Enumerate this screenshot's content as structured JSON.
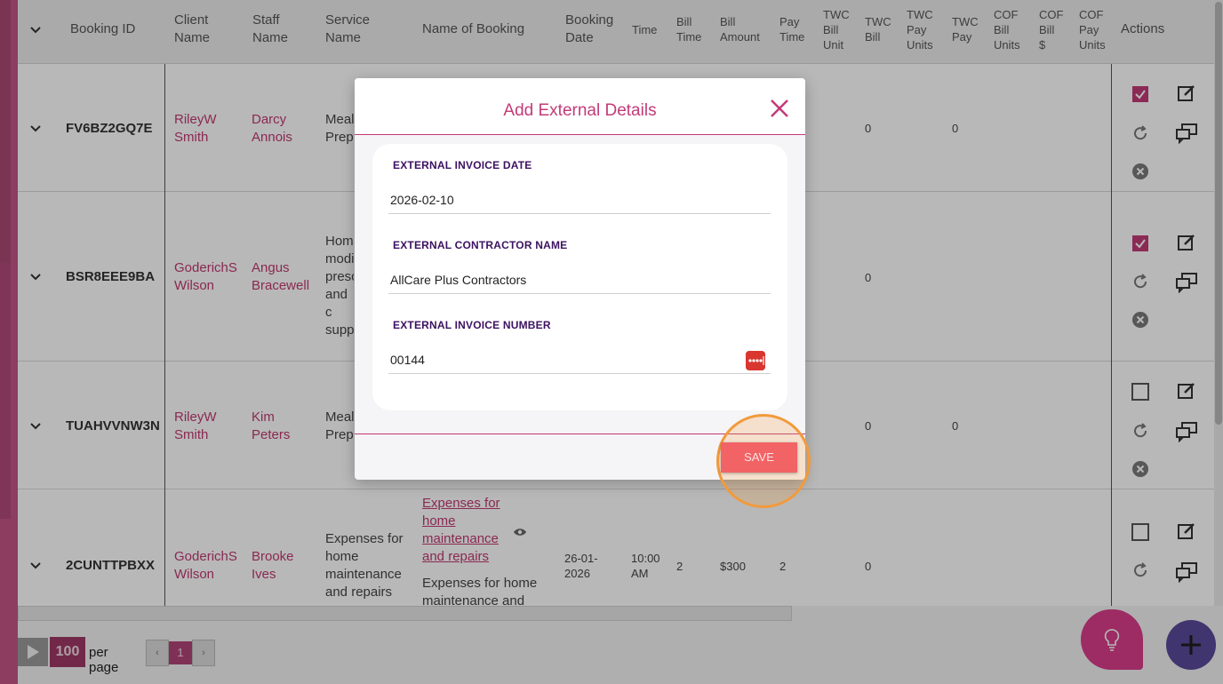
{
  "table": {
    "columns": [
      {
        "label": "Booking ID"
      },
      {
        "label": "Client Name"
      },
      {
        "label": "Staff Name"
      },
      {
        "label": "Service Name"
      },
      {
        "label": "Name of Booking"
      },
      {
        "label": "Booking Date"
      },
      {
        "label": "Time"
      },
      {
        "label": "Bill Time"
      },
      {
        "label": "Bill Amount"
      },
      {
        "label": "Pay Time"
      },
      {
        "label": "TWC Bill Unit"
      },
      {
        "label": "TWC Bill"
      },
      {
        "label": "TWC Pay Units"
      },
      {
        "label": "TWC Pay"
      },
      {
        "label": "COF Bill Units"
      },
      {
        "label": "COF Bill $"
      },
      {
        "label": "COF Pay Units"
      },
      {
        "label": "Actions"
      }
    ],
    "rows": [
      {
        "booking_id": "FV6BZ2GQ7E",
        "client": "RileyW Smith",
        "staff": "Darcy Annois",
        "service": "Meal Prepa",
        "twc_bill": "0",
        "twc_pay": "0",
        "approved": true
      },
      {
        "booking_id": "BSR8EEE9BA",
        "client": "GoderichS Wilson",
        "staff": "Angus Bracewell",
        "service": "Hom modi presc and c supp",
        "twc_bill": "0",
        "twc_pay": "",
        "approved": true
      },
      {
        "booking_id": "TUAHVVNW3N",
        "client": "RileyW Smith",
        "staff": "Kim Peters",
        "service": "Meal Prepa",
        "twc_bill": "0",
        "twc_pay": "0",
        "approved": false
      },
      {
        "booking_id": "2CUNTTPBXX",
        "client": "GoderichS Wilson",
        "staff": "Brooke Ives",
        "service": "Expenses for home maintenance and repairs",
        "booking_name_link": "Expenses for home maintenance and repairs",
        "booking_name_desc": "Expenses for home maintenance and",
        "date": "26-01-2026",
        "time": "10:00 AM",
        "bill_time": "2",
        "bill_amount": "$300",
        "pay_time": "2",
        "twc_bill": "0",
        "twc_pay": "",
        "approved": false
      }
    ]
  },
  "pagination": {
    "page_size": "100",
    "per_page_label": "per page",
    "prev": "‹",
    "next": "›",
    "current_page": "1"
  },
  "modal": {
    "title": "Add External Details",
    "fields": {
      "invoice_date": {
        "label": "EXTERNAL INVOICE DATE",
        "value": "2026-02-10"
      },
      "contractor_name": {
        "label": "EXTERNAL CONTRACTOR NAME",
        "value": "AllCare Plus Contractors"
      },
      "invoice_number": {
        "label": "EXTERNAL INVOICE NUMBER",
        "value": "00144"
      }
    },
    "save_label": "SAVE"
  },
  "colors": {
    "accent": "#c23b78",
    "save": "#f26366",
    "highlight": "#f29a3c",
    "fab_idea": "#d93d8a",
    "fab_add": "#5a4a9a"
  },
  "icons": [
    "chevron-down-icon",
    "checkbox-icon",
    "edit-icon",
    "refresh-icon",
    "chat-icon",
    "cancel-icon",
    "eye-icon",
    "close-icon",
    "password-dots-icon",
    "lightbulb-icon",
    "plus-icon",
    "play-icon"
  ]
}
